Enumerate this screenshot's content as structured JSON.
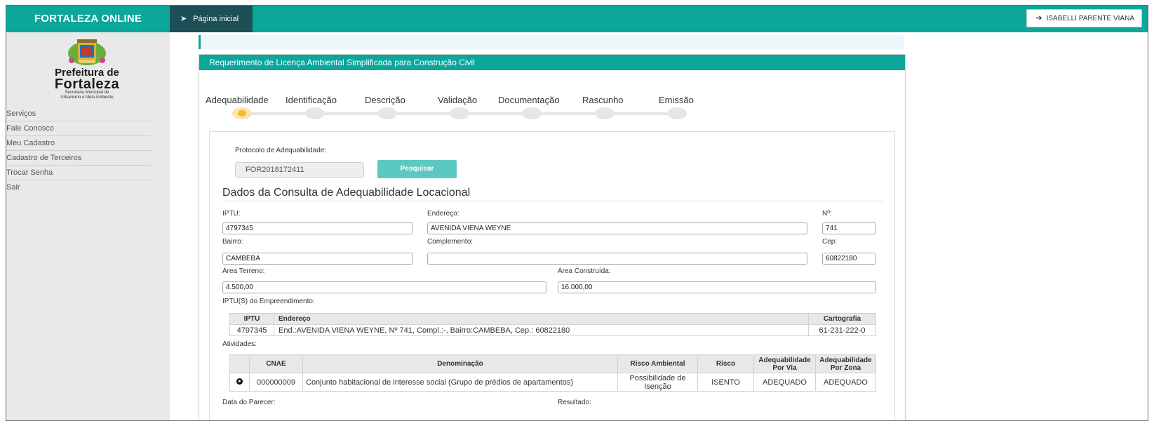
{
  "topbar": {
    "brand": "FORTALEZA ONLINE",
    "home_tab": "Página inicial",
    "user_button": "ISABELLI PARENTE VIANA"
  },
  "sidebar": {
    "logo": {
      "line1": "Prefeitura de",
      "line2": "Fortaleza",
      "line3a": "Secretaria Municipal de",
      "line3b": "Urbanismo e Meio Ambiente"
    },
    "items": [
      {
        "label": "Serviços"
      },
      {
        "label": "Fale Conosco"
      },
      {
        "label": "Meu Cadastro"
      },
      {
        "label": "Cadastro de Terceiros"
      },
      {
        "label": "Trocar Senha"
      },
      {
        "label": "Sair"
      }
    ]
  },
  "panel": {
    "title": "Requerimento de Licença Ambiental Simplificada para Construção Civil"
  },
  "steps": [
    {
      "label": "Adequabilidade",
      "active": true
    },
    {
      "label": "Identificação"
    },
    {
      "label": "Descrição"
    },
    {
      "label": "Validação"
    },
    {
      "label": "Documentação"
    },
    {
      "label": "Rascunho"
    },
    {
      "label": "Emissão"
    }
  ],
  "search": {
    "label": "Protocolo de Adequabilidade:",
    "value": "FOR2018172411",
    "button": "Pesquisar"
  },
  "consulta": {
    "title": "Dados da Consulta de Adequabilidade Locacional",
    "iptu_label": "IPTU:",
    "iptu_value": "4797345",
    "endereco_label": "Endereço:",
    "endereco_value": "AVENIDA VIENA WEYNE",
    "numero_label": "Nº:",
    "numero_value": "741",
    "bairro_label": "Bairro:",
    "bairro_value": "CAMBEBA",
    "complemento_label": "Complemento:",
    "complemento_value": "",
    "cep_label": "Cep:",
    "cep_value": "60822180",
    "area_terreno_label": "Área Terreno:",
    "area_terreno_value": "4.500,00",
    "area_construida_label": "Área Construída:",
    "area_construida_value": "16.000,00",
    "iptus_label": "IPTU(S) do Empreendimento:",
    "atividades_label": "Atividades:",
    "data_parecer_label": "Data do Parecer:",
    "resultado_label": "Resultado:"
  },
  "iptu_table": {
    "headers": {
      "iptu": "IPTU",
      "endereco": "Endereço",
      "cartografia": "Cartografia"
    },
    "rows": [
      {
        "iptu": "4797345",
        "endereco": "End.:AVENIDA VIENA WEYNE, Nº 741, Compl.:-, Bairro:CAMBEBA, Cep.: 60822180",
        "cartografia": "61-231-222-0"
      }
    ]
  },
  "atividades_table": {
    "headers": {
      "cnae": "CNAE",
      "denominacao": "Denominação",
      "risco_ambiental": "Risco Ambiental",
      "risco": "Risco",
      "via": "Adequabilidade Por Via",
      "zona": "Adequabilidade Por Zona"
    },
    "rows": [
      {
        "cnae": "000000009",
        "denominacao": "Conjunto habitacional de interesse social (Grupo de prédios de apartamentos)",
        "risco_ambiental": "Possibilidade de Isenção",
        "risco": "ISENTO",
        "via": "ADEQUADO",
        "zona": "ADEQUADO"
      }
    ]
  }
}
